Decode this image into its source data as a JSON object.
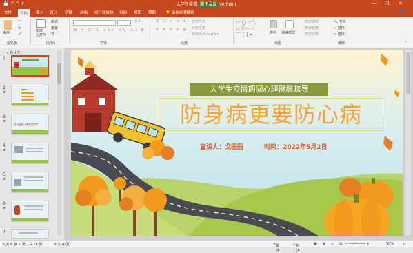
{
  "window": {
    "title": "大学生疫情期间心理健康疏导 - PowerPoint",
    "title_left": "大学生疫情",
    "title_right": "verPoint",
    "meeting_badge": "腾讯会议",
    "minimize": "—",
    "restore": "❐",
    "close": "✕"
  },
  "tabs": [
    "文件",
    "开始",
    "插入",
    "设计",
    "切换",
    "动画",
    "幻灯片放映",
    "审阅",
    "视图",
    "帮助",
    "操作说明搜索"
  ],
  "active_tab": "开始",
  "ribbon": {
    "groups": [
      "剪贴板",
      "幻灯片",
      "字体",
      "段落",
      "绘图",
      "编辑"
    ],
    "paste": "粘贴",
    "new_slide": "新建\n幻灯片",
    "layout": "版式",
    "reset": "重置",
    "section": "节",
    "text_direction": "文字方向",
    "align_text": "对齐文本",
    "smartart": "转换为 SmartArt",
    "shape_fill": "形状填充",
    "shape_outline": "形状轮廓",
    "shape_effect": "形状效果",
    "quick_style": "快速样式",
    "arrange": "排列",
    "find": "查找",
    "replace": "替换",
    "select": "选择"
  },
  "thumbnails": {
    "section_label": "默认节",
    "items": [
      {
        "num": "1",
        "selected": true
      },
      {
        "num": "2",
        "selected": false
      },
      {
        "num": "3",
        "selected": false,
        "caption": "学生疫情心理健康疏导"
      },
      {
        "num": "4",
        "selected": false
      },
      {
        "num": "5",
        "selected": false
      },
      {
        "num": "6",
        "selected": false
      },
      {
        "num": "7",
        "selected": false
      }
    ]
  },
  "slide": {
    "banner": "大学生疫情期间心理健康疏导",
    "title": "防身病更要防心病",
    "speaker_label": "宣讲人：戈园园",
    "time_label": "时间：2022年5月2日"
  },
  "status": {
    "slide_count": "幻灯片 第 1 张，共 26 张",
    "language": "中文(中国)",
    "notes": "备注",
    "comments": "批注",
    "zoom": "90%"
  }
}
